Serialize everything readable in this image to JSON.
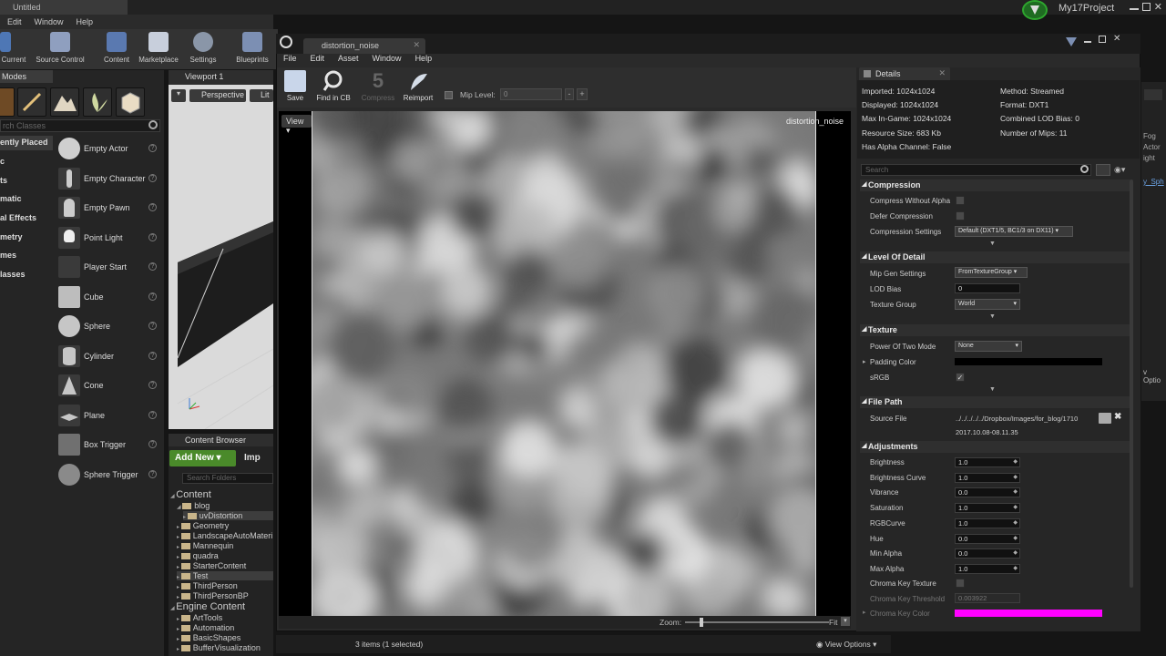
{
  "back_editor": {
    "title": "Untitled",
    "project_name": "My17Project",
    "menu": [
      "Edit",
      "Window",
      "Help"
    ],
    "toolbar": [
      "Current",
      "Source Control",
      "Content",
      "Marketplace",
      "Settings",
      "Blueprints"
    ],
    "modes_tab": "Modes",
    "modes_search_placeholder": "rch Classes",
    "categories": [
      "ently Placed",
      "c",
      "ts",
      "matic",
      "al Effects",
      "metry",
      "mes",
      "lasses"
    ],
    "place_items": [
      "Empty Actor",
      "Empty Character",
      "Empty Pawn",
      "Point Light",
      "Player Start",
      "Cube",
      "Sphere",
      "Cylinder",
      "Cone",
      "Plane",
      "Box Trigger",
      "Sphere Trigger"
    ],
    "viewport_tab": "Viewport 1",
    "viewport_perspective": "Perspective",
    "viewport_lit": "Lit",
    "content_browser_tab": "Content Browser",
    "add_new": "Add New",
    "import": "Imp",
    "search_folders": "Search Folders",
    "tree": [
      {
        "label": "Content",
        "level": 0,
        "big": true
      },
      {
        "label": "blog",
        "level": 1
      },
      {
        "label": "uvDistortion",
        "level": 2,
        "selected": true
      },
      {
        "label": "Geometry",
        "level": 1
      },
      {
        "label": "LandscapeAutoMateri",
        "level": 1
      },
      {
        "label": "Mannequin",
        "level": 1
      },
      {
        "label": "quadra",
        "level": 1
      },
      {
        "label": "StarterContent",
        "level": 1
      },
      {
        "label": "Test",
        "level": 1,
        "selected": true
      },
      {
        "label": "ThirdPerson",
        "level": 1
      },
      {
        "label": "ThirdPersonBP",
        "level": 1
      },
      {
        "label": "Engine Content",
        "level": 0,
        "big": true
      },
      {
        "label": "ArtTools",
        "level": 1
      },
      {
        "label": "Automation",
        "level": 1
      },
      {
        "label": "BasicShapes",
        "level": 1
      },
      {
        "label": "BufferVisualization",
        "level": 1
      }
    ],
    "status_items": "3 items (1 selected)",
    "view_options": "View Options",
    "right_edge_text": [
      "Fog",
      "Actor",
      "ight",
      "y_Sph",
      "v Optio"
    ]
  },
  "editor": {
    "tab_title": "distortion_noise",
    "menu": [
      "File",
      "Edit",
      "Asset",
      "Window",
      "Help"
    ],
    "toolbar": {
      "save": "Save",
      "find_in_cb": "Find in CB",
      "compress": "Compress",
      "reimport": "Reimport",
      "mip_level_label": "Mip Level:",
      "mip_level_value": "0"
    },
    "view_button": "View",
    "canvas_label": "distortion_noise",
    "zoom_label": "Zoom:",
    "zoom_fit": "Fit",
    "zoom_slider_fraction": 0.1
  },
  "details": {
    "tab": "Details",
    "info_left": [
      "Imported: 1024x1024",
      "Displayed: 1024x1024",
      "Max In-Game: 1024x1024",
      "Resource Size: 683 Kb",
      "Has Alpha Channel: False"
    ],
    "info_right": [
      "Method: Streamed",
      "Format: DXT1",
      "Combined LOD Bias: 0",
      "Number of Mips: 11"
    ],
    "search_placeholder": "Search",
    "compression": {
      "title": "Compression",
      "compress_without_alpha": "Compress Without Alpha",
      "defer_compression": "Defer Compression",
      "compression_settings": "Compression Settings",
      "compression_settings_value": "Default (DXT1/5, BC1/3 on DX11)"
    },
    "lod": {
      "title": "Level Of Detail",
      "mip_gen_settings": "Mip Gen Settings",
      "mip_gen_settings_value": "FromTextureGroup",
      "lod_bias": "LOD Bias",
      "lod_bias_value": "0",
      "texture_group": "Texture Group",
      "texture_group_value": "World"
    },
    "texture": {
      "title": "Texture",
      "power_of_two_mode": "Power Of Two Mode",
      "power_of_two_value": "None",
      "padding_color": "Padding Color",
      "padding_color_hex": "#000000",
      "srgb": "sRGB",
      "srgb_checked": true
    },
    "file_path": {
      "title": "File Path",
      "source_file": "Source File",
      "source_file_value": "../../../../../Dropbox/Images/for_blog/1710",
      "source_timestamp": "2017.10.08-08.11.35"
    },
    "adjustments": {
      "title": "Adjustments",
      "rows": [
        {
          "label": "Brightness",
          "value": "1.0"
        },
        {
          "label": "Brightness Curve",
          "value": "1.0"
        },
        {
          "label": "Vibrance",
          "value": "0.0"
        },
        {
          "label": "Saturation",
          "value": "1.0"
        },
        {
          "label": "RGBCurve",
          "value": "1.0"
        },
        {
          "label": "Hue",
          "value": "0.0"
        },
        {
          "label": "Min Alpha",
          "value": "0.0"
        },
        {
          "label": "Max Alpha",
          "value": "1.0"
        }
      ],
      "chroma_key_texture": "Chroma Key Texture",
      "chroma_key_threshold": "Chroma Key Threshold",
      "chroma_key_threshold_value": "0.003922",
      "chroma_key_color": "Chroma Key Color",
      "chroma_key_color_hex": "#ff00ff"
    }
  },
  "colors": {
    "accent_green": "#4a8a2a",
    "panel": "#262626",
    "chroma": "#ff00ff"
  }
}
